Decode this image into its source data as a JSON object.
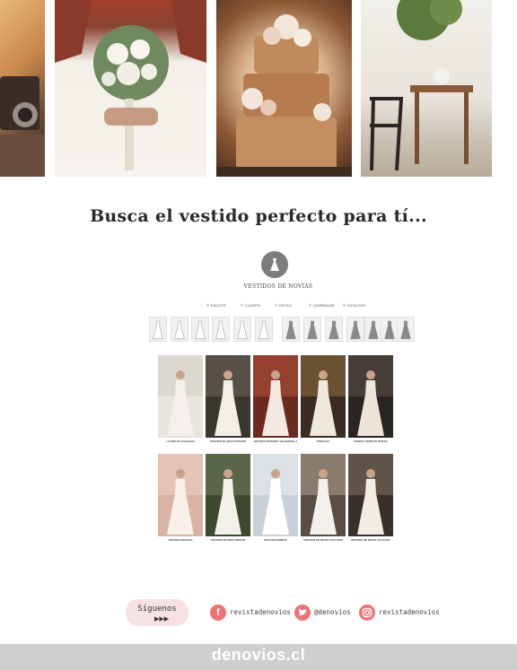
{
  "section": {
    "title": "Busca el vestido perfecto para tí..."
  },
  "catalog": {
    "heading": "VESTIDOS DE NOVIAS",
    "filters": [
      "ESCOTE",
      "CUERPO",
      "ESTILO",
      "DISEÑADOR",
      "ESTACION"
    ],
    "silhouettes": 13,
    "cards": [
      {
        "name": "LAURE DE SAGAZAN",
        "sub": ""
      },
      {
        "name": "VESTIDO BLANCO ESTAÑO",
        "sub": ""
      },
      {
        "name": "VESTIDO ROSARIO VALENZUELA",
        "sub": ""
      },
      {
        "name": "PITRALEY",
        "sub": ""
      },
      {
        "name": "ENRICO CERRUTI ROSAS",
        "sub": ""
      },
      {
        "name": "VESTIDO NATIVAS",
        "sub": ""
      },
      {
        "name": "VESTIDO BLANCO MONTE",
        "sub": ""
      },
      {
        "name": "MIYE MATERNITÉ",
        "sub": ""
      },
      {
        "name": "VESTIDO DE NOVIA SAUCEDA",
        "sub": ""
      },
      {
        "name": "VESTIDO DE NOVIA SAUCEDA",
        "sub": ""
      }
    ]
  },
  "social": {
    "follow_label": "Síguenos",
    "follow_arrows": "▶▶▶",
    "facebook_handle": "revistadenovios",
    "twitter_handle": "@denovios",
    "instagram_handle": "revistadenovios",
    "accent_color": "#f07276"
  },
  "footer": {
    "brand": "denovios.cl"
  }
}
